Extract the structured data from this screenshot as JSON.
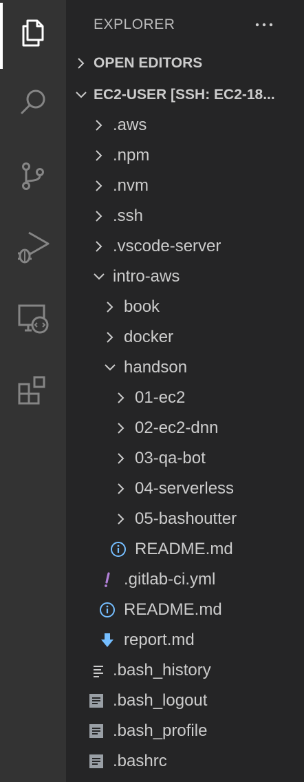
{
  "explorer": {
    "title": "EXPLORER",
    "sections": {
      "open_editors": "OPEN EDITORS",
      "workspace": "EC2-USER [SSH: EC2-18..."
    }
  },
  "activity_bar": {
    "items": [
      "explorer-icon",
      "search-icon",
      "source-control-icon",
      "run-debug-icon",
      "remote-explorer-icon",
      "extensions-icon"
    ]
  },
  "tree": {
    "aws": ".aws",
    "npm": ".npm",
    "nvm": ".nvm",
    "ssh": ".ssh",
    "vscode_server": ".vscode-server",
    "intro_aws": "intro-aws",
    "book": "book",
    "docker": "docker",
    "handson": "handson",
    "ec2": "01-ec2",
    "ec2_dnn": "02-ec2-dnn",
    "qa_bot": "03-qa-bot",
    "serverless": "04-serverless",
    "bashoutter": "05-bashoutter",
    "handson_readme": "README.md",
    "gitlab_ci": ".gitlab-ci.yml",
    "intro_readme": "README.md",
    "report": "report.md",
    "bash_history": ".bash_history",
    "bash_logout": ".bash_logout",
    "bash_profile": ".bash_profile",
    "bashrc": ".bashrc"
  },
  "colors": {
    "activity_bar": "#333333",
    "sidebar": "#252526",
    "info_icon": "#75beff",
    "yaml_icon": "#b180d7",
    "download_icon": "#75beff"
  }
}
